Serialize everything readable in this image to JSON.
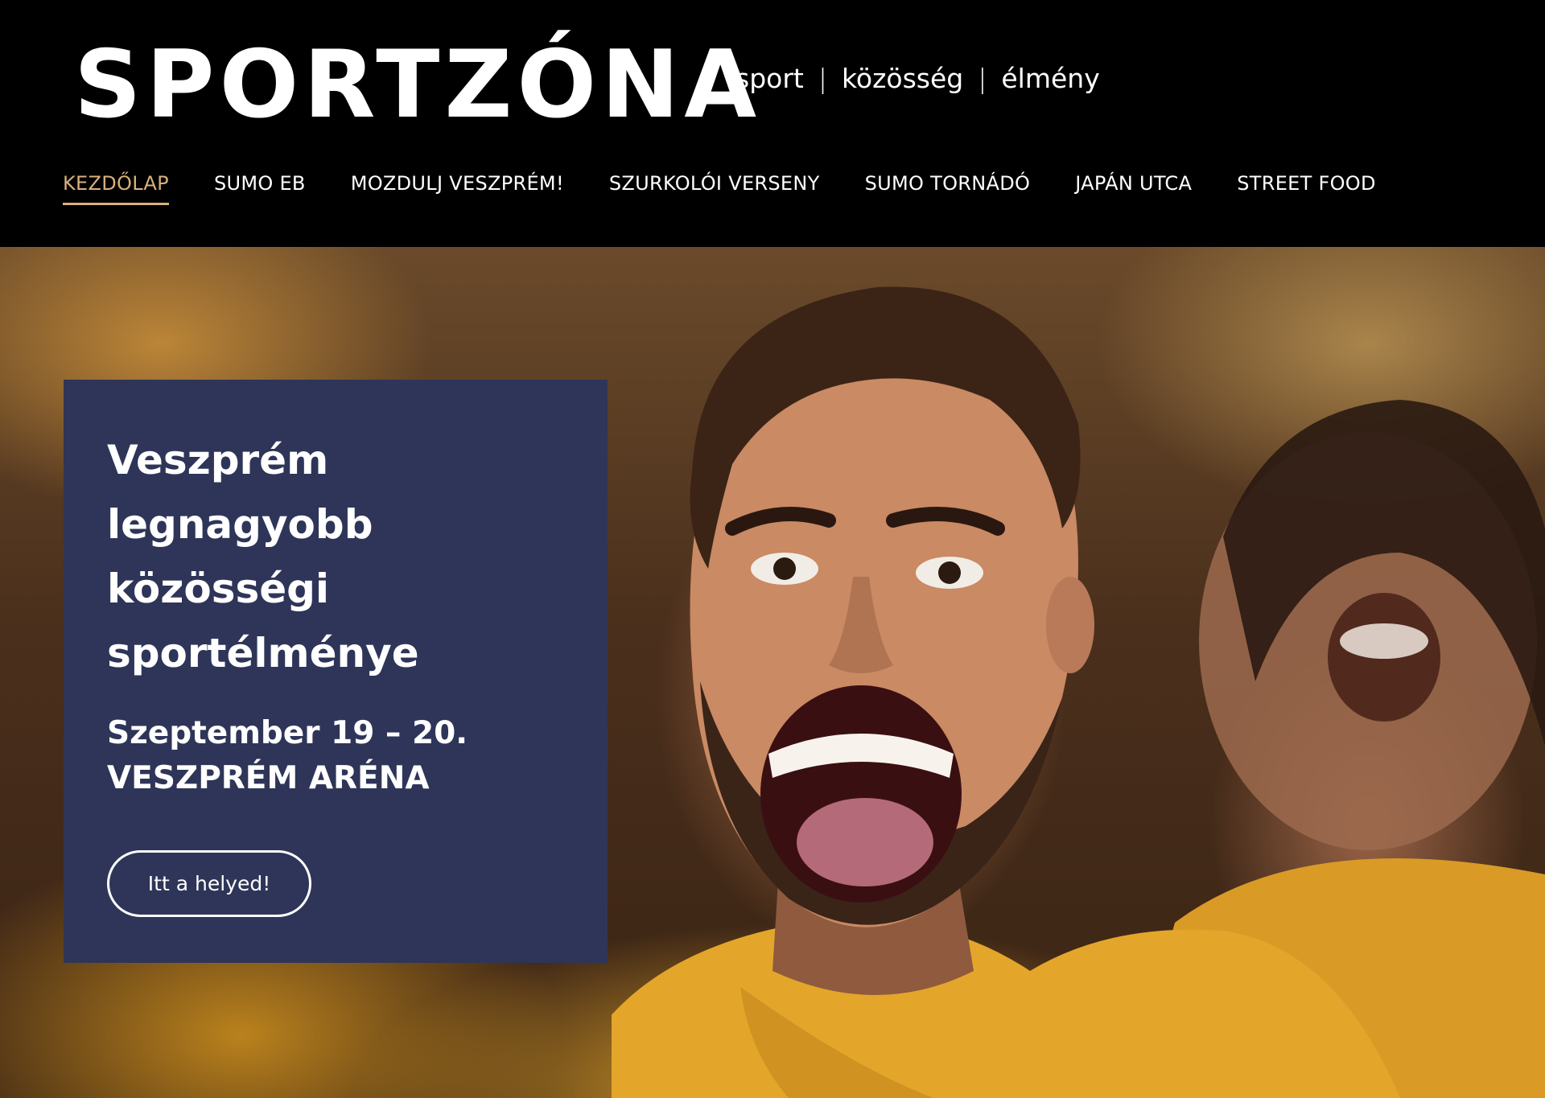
{
  "header": {
    "logo_text": "SPORTZÓNA",
    "tagline": {
      "items": [
        "sport",
        "közösség",
        "élmény"
      ],
      "separator": "|"
    }
  },
  "nav": {
    "items": [
      {
        "label": "KEZDŐLAP",
        "active": true
      },
      {
        "label": "SUMO EB",
        "active": false
      },
      {
        "label": "MOZDULJ VESZPRÉM!",
        "active": false
      },
      {
        "label": "SZURKOLÓI VERSENY",
        "active": false
      },
      {
        "label": "SUMO TORNÁDÓ",
        "active": false
      },
      {
        "label": "JAPÁN UTCA",
        "active": false
      },
      {
        "label": "STREET FOOD",
        "active": false
      }
    ]
  },
  "hero": {
    "heading": "Veszprém legnagyobb közösségi sportélménye",
    "date_line": "Szeptember 19 – 20.",
    "venue_line": "VESZPRÉM ARÉNA",
    "cta_label": "Itt a helyed!"
  },
  "colors": {
    "header_bg": "#000000",
    "nav_active": "#d8b07a",
    "card_bg": "#2e3558",
    "text": "#ffffff",
    "jersey_yellow": "#e3a62a"
  }
}
